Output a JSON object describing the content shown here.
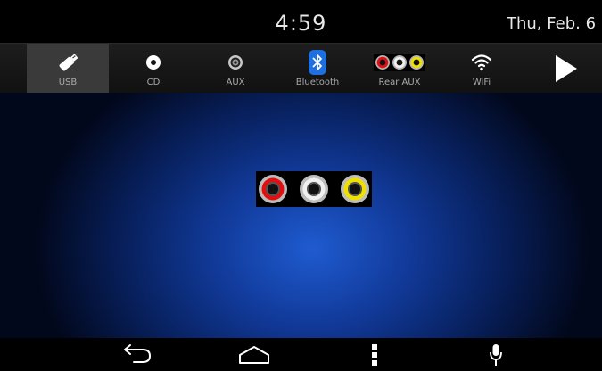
{
  "status": {
    "time": "4:59",
    "date": "Thu, Feb. 6"
  },
  "sources": [
    {
      "label": "USB",
      "icon": "usb-stick-icon",
      "active": true
    },
    {
      "label": "CD",
      "icon": "cd-icon",
      "active": false
    },
    {
      "label": "AUX",
      "icon": "aux-jack-icon",
      "active": false
    },
    {
      "label": "Bluetooth",
      "icon": "bluetooth-icon",
      "active": false
    },
    {
      "label": "Rear AUX",
      "icon": "rca-jacks-icon",
      "active": false
    },
    {
      "label": "WiFi",
      "icon": "wifi-icon",
      "active": false
    }
  ],
  "next": {
    "icon": "play-next-icon"
  },
  "main": {
    "icon": "rca-jacks-icon"
  },
  "nav": [
    {
      "name": "back",
      "icon": "back-arrow-icon"
    },
    {
      "name": "home",
      "icon": "home-icon"
    },
    {
      "name": "menu",
      "icon": "menu-dots-icon"
    },
    {
      "name": "voice",
      "icon": "microphone-icon"
    }
  ],
  "colors": {
    "active_tab": "#3a3a3a",
    "bluetooth_blue": "#1e6fe0",
    "rca_red": "#e01010",
    "rca_white": "#f0f0f0",
    "rca_yellow": "#f0e000"
  }
}
